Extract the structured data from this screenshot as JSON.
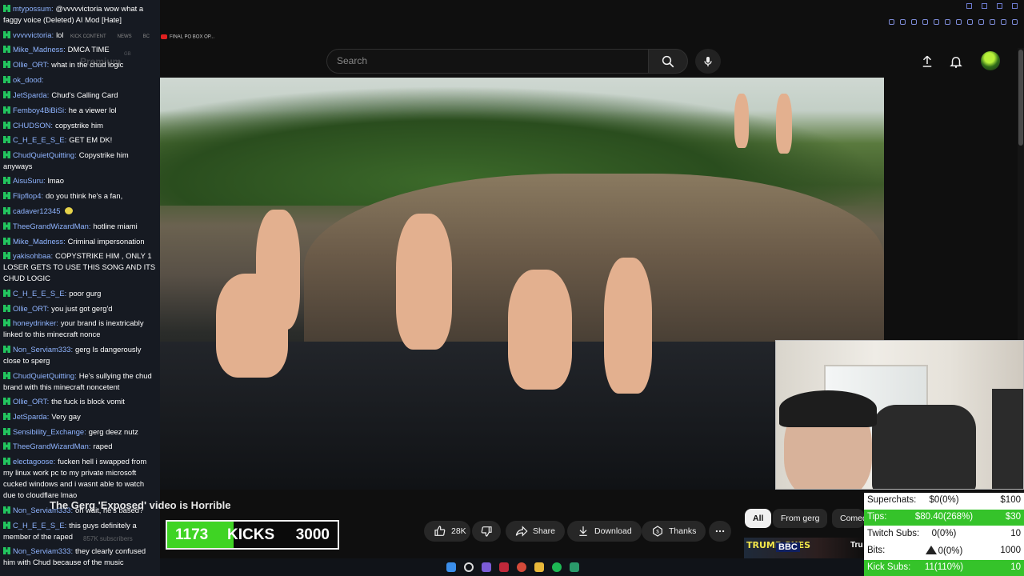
{
  "browser": {
    "bookmarks": [
      "KICK CONTENT",
      "NEWS",
      "BC",
      "FINAL PO BOX OP..."
    ]
  },
  "masthead": {
    "search_placeholder": "Search",
    "premium_label": "Premium",
    "region": "GB"
  },
  "chat": {
    "messages": [
      {
        "user": "mtypossum",
        "text": "@vvvvvictoria wow what a faggy voice (Deleted) AI Mod [Hate]"
      },
      {
        "user": "vvvvvictoria",
        "text": "lol"
      },
      {
        "user": "Mike_Madness",
        "text": "DMCA TIME"
      },
      {
        "user": "Ollie_ORT",
        "text": "what in the chud logic"
      },
      {
        "user": "ok_dood",
        "text": ""
      },
      {
        "user": "JetSparda",
        "text": "Chud's Calling Card"
      },
      {
        "user": "Femboy4BiBiSi",
        "text": "he a viewer lol"
      },
      {
        "user": "CHUDSON",
        "text": "copystrike him"
      },
      {
        "user": "C_H_E_E_S_E",
        "text": "GET EM DK!"
      },
      {
        "user": "ChudQuietQuitting",
        "text": "Copystrike him anyways"
      },
      {
        "user": "AisuSuru",
        "text": "lmao"
      },
      {
        "user": "Flipflop4",
        "text": "do you think he's a fan,"
      },
      {
        "user": "cadaver12345",
        "text": ""
      },
      {
        "user": "TheeGrandWizardMan",
        "text": "hotline miami"
      },
      {
        "user": "Mike_Madness",
        "text": "Criminal impersonation"
      },
      {
        "user": "yakisohbaa",
        "text": "COPYSTRIKE HIM , ONLY 1 LOSER GETS TO USE THIS SONG AND ITS CHUD LOGIC"
      },
      {
        "user": "C_H_E_E_S_E",
        "text": "poor gurg"
      },
      {
        "user": "Ollie_ORT",
        "text": "you just got gerg'd"
      },
      {
        "user": "honeydrinker",
        "text": "your brand is inextricably linked to this minecraft nonce"
      },
      {
        "user": "Non_Serviam333",
        "text": "gerg Is dangerously close to sperg"
      },
      {
        "user": "ChudQuietQuitting",
        "text": "He's sullying the chud brand with this minecraft noncetent"
      },
      {
        "user": "Ollie_ORT",
        "text": "the fuck is block vomit"
      },
      {
        "user": "JetSparda",
        "text": "Very gay"
      },
      {
        "user": "Sensibility_Exchange",
        "text": "gerg deez nutz"
      },
      {
        "user": "TheeGrandWizardMan",
        "text": "raped"
      },
      {
        "user": "electagoose",
        "text": "fucken hell i swapped from my linux work pc to my private microsoft cucked windows and i wasnt able to watch due to cloudflare lmao"
      },
      {
        "user": "Non_Serviam333",
        "text": "oh wait, he's based?"
      },
      {
        "user": "C_H_E_E_S_E",
        "text": "this guys definitely a member of the raped"
      },
      {
        "user": "Non_Serviam333",
        "text": "they clearly confused him with Chud because of the music"
      }
    ]
  },
  "video": {
    "title": "The Gerg 'Exposed' video is Horrible",
    "channel_subs": "857K subscribers"
  },
  "actions": {
    "likes": "28K",
    "share": "Share",
    "download": "Download",
    "thanks": "Thanks"
  },
  "chips": [
    "All",
    "From gerg",
    "Comedy"
  ],
  "recommendation": {
    "thumb_text": "TRUMP SUES",
    "thumb_badge": "BBC",
    "title": "Tru"
  },
  "kicks": {
    "count": "1173",
    "label": "KICKS",
    "goal": "3000",
    "progress": 0.391
  },
  "stats": [
    {
      "label": "Superchats:",
      "value": "$0(0%)",
      "goal": "$100",
      "highlight": false
    },
    {
      "label": "Tips:",
      "value": "$80.40(268%)",
      "goal": "$30",
      "highlight": true
    },
    {
      "label": "Twitch Subs:",
      "value": "0(0%)",
      "goal": "10",
      "highlight": false
    },
    {
      "label": "Bits:",
      "value": "0(0%)",
      "goal": "1000",
      "highlight": false
    },
    {
      "label": "Kick Subs:",
      "value": "11(110%)",
      "goal": "10",
      "highlight": true
    }
  ],
  "colors": {
    "chat_bg": "#161a22",
    "username": "#8fb4ff",
    "kick_green": "#3fd424",
    "stat_green": "#35c32a"
  }
}
